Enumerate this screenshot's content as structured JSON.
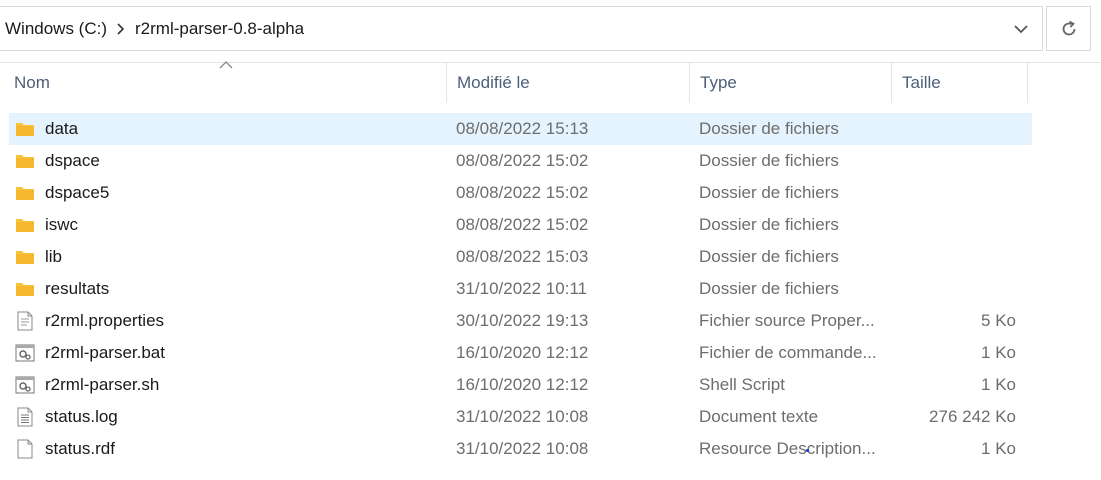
{
  "address": {
    "crumbs": [
      "Windows (C:)",
      "r2rml-parser-0.8-alpha"
    ]
  },
  "columns": {
    "name": "Nom",
    "modified": "Modifié le",
    "type": "Type",
    "size": "Taille"
  },
  "files": [
    {
      "name": "data",
      "modified": "08/08/2022 15:13",
      "type": "Dossier de fichiers",
      "size": "",
      "icon": "folder-icon",
      "selected": true
    },
    {
      "name": "dspace",
      "modified": "08/08/2022 15:02",
      "type": "Dossier de fichiers",
      "size": "",
      "icon": "folder-icon"
    },
    {
      "name": "dspace5",
      "modified": "08/08/2022 15:02",
      "type": "Dossier de fichiers",
      "size": "",
      "icon": "folder-icon"
    },
    {
      "name": "iswc",
      "modified": "08/08/2022 15:02",
      "type": "Dossier de fichiers",
      "size": "",
      "icon": "folder-icon"
    },
    {
      "name": "lib",
      "modified": "08/08/2022 15:03",
      "type": "Dossier de fichiers",
      "size": "",
      "icon": "folder-icon"
    },
    {
      "name": "resultats",
      "modified": "31/10/2022 10:11",
      "type": "Dossier de fichiers",
      "size": "",
      "icon": "folder-icon"
    },
    {
      "name": "r2rml.properties",
      "modified": "30/10/2022 19:13",
      "type": "Fichier source Proper...",
      "size": "5 Ko",
      "icon": "properties-file-icon"
    },
    {
      "name": "r2rml-parser.bat",
      "modified": "16/10/2020 12:12",
      "type": "Fichier de commande...",
      "size": "1 Ko",
      "icon": "batch-file-icon"
    },
    {
      "name": "r2rml-parser.sh",
      "modified": "16/10/2020 12:12",
      "type": "Shell Script",
      "size": "1 Ko",
      "icon": "script-file-icon"
    },
    {
      "name": "status.log",
      "modified": "31/10/2022 10:08",
      "type": "Document texte",
      "size": "276 242 Ko",
      "icon": "text-file-icon"
    },
    {
      "name": "status.rdf",
      "modified": "31/10/2022 10:08",
      "type": "Resource Description...",
      "size": "1 Ko",
      "icon": "blank-file-icon"
    }
  ],
  "colors": {
    "selection": "#e5f3ff",
    "folder": "#f8c43c",
    "header_text": "#4c607a"
  }
}
